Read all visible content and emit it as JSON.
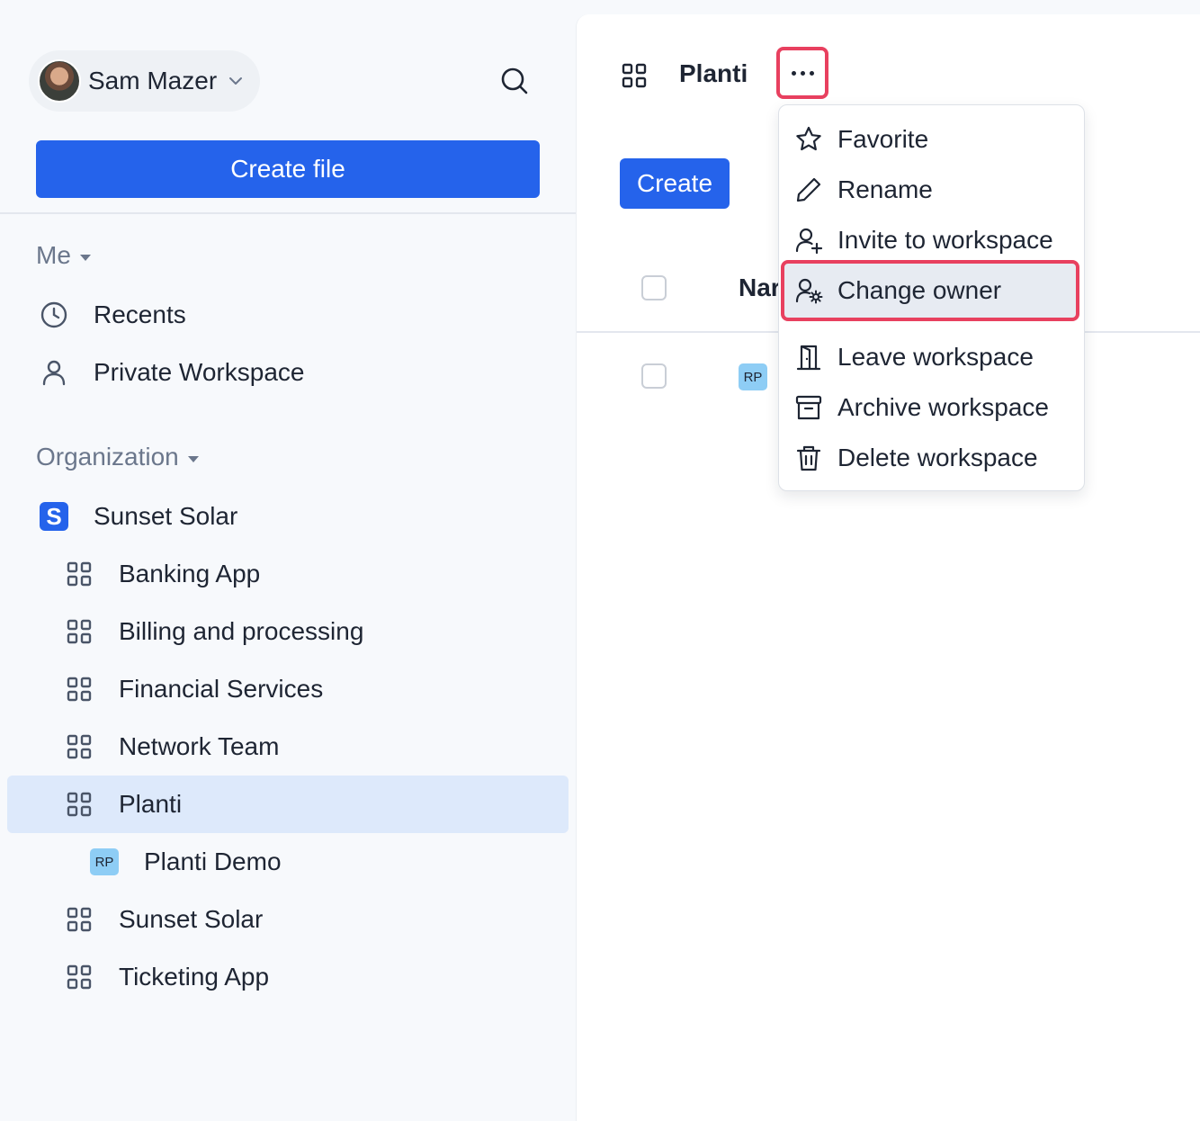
{
  "user": {
    "name": "Sam Mazer"
  },
  "sidebar": {
    "create_file_label": "Create file",
    "me_section": {
      "label": "Me",
      "items": [
        {
          "label": "Recents",
          "icon": "clock-icon"
        },
        {
          "label": "Private Workspace",
          "icon": "user-icon"
        }
      ]
    },
    "org_section": {
      "label": "Organization",
      "org": {
        "label": "Sunset Solar",
        "logo_letter": "S"
      },
      "workspaces": [
        {
          "label": "Banking App"
        },
        {
          "label": "Billing and processing"
        },
        {
          "label": "Financial Services"
        },
        {
          "label": "Network Team"
        },
        {
          "label": "Planti",
          "active": true
        },
        {
          "label": "Planti Demo",
          "badge": "RP"
        },
        {
          "label": "Sunset Solar"
        },
        {
          "label": "Ticketing App"
        }
      ]
    }
  },
  "main": {
    "title": "Planti",
    "create_label": "Create",
    "name_column_visible": "Nar",
    "row_badge": "RP"
  },
  "menu": {
    "items": [
      {
        "label": "Favorite",
        "icon": "star-icon"
      },
      {
        "label": "Rename",
        "icon": "pencil-icon"
      },
      {
        "label": "Invite to workspace",
        "icon": "user-plus-icon"
      },
      {
        "label": "Change owner",
        "icon": "user-gear-icon",
        "highlighted": true
      },
      {
        "label": "Leave workspace",
        "icon": "door-icon"
      },
      {
        "label": "Archive workspace",
        "icon": "archive-icon"
      },
      {
        "label": "Delete workspace",
        "icon": "trash-icon"
      }
    ]
  },
  "colors": {
    "accent": "#2563eb",
    "highlight": "#e8405f",
    "active_bg": "#dde9fb",
    "badge": "#8ecdf5"
  }
}
